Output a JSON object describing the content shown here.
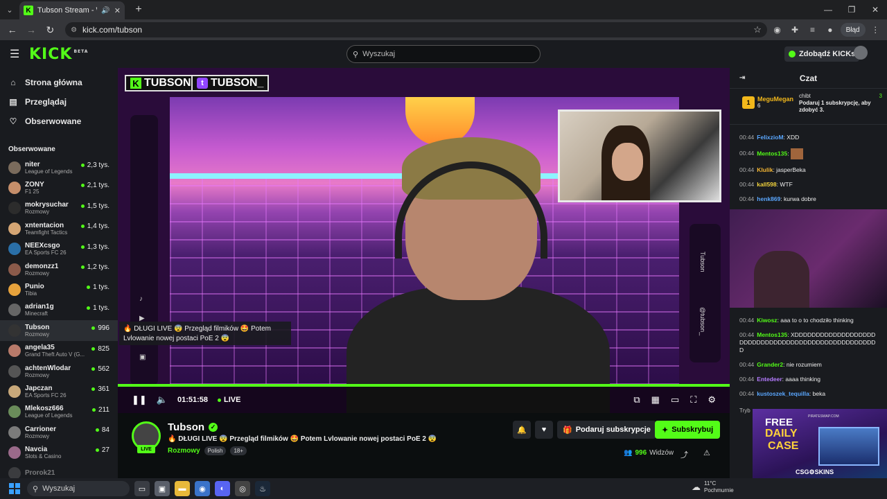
{
  "browser": {
    "tab_title": "Tubson Stream - Watch Liv",
    "url": "kick.com/tubson",
    "error_label": "Błąd"
  },
  "header": {
    "logo": "KICK",
    "logo_badge": "BETA",
    "search_placeholder": "Wyszukaj",
    "kicks_label": "Zdobądź KICKs"
  },
  "sidebar": {
    "nav": [
      {
        "label": "Strona główna",
        "icon": "home-icon"
      },
      {
        "label": "Przeglądaj",
        "icon": "browse-icon"
      },
      {
        "label": "Obserwowane",
        "icon": "heart-icon"
      }
    ],
    "followed_title": "Obserwowane",
    "channels": [
      {
        "name": "niter",
        "category": "League of Legends",
        "viewers": "2,3 tys."
      },
      {
        "name": "ZONY",
        "category": "F1 25",
        "viewers": "2,1 tys."
      },
      {
        "name": "mokrysuchar",
        "category": "Rozmowy",
        "viewers": "1,5 tys."
      },
      {
        "name": "xntentacion",
        "category": "Teamfight Tactics",
        "viewers": "1,4 tys."
      },
      {
        "name": "NEEXcsgo",
        "category": "EA Sports FC 26",
        "viewers": "1,3 tys."
      },
      {
        "name": "demonzz1",
        "category": "Rozmowy",
        "viewers": "1,2 tys."
      },
      {
        "name": "Punio",
        "category": "Tibia",
        "viewers": "1 tys."
      },
      {
        "name": "adrian1g",
        "category": "Minecraft",
        "viewers": "1 tys."
      },
      {
        "name": "Tubson",
        "category": "Rozmowy",
        "viewers": "996"
      },
      {
        "name": "angela35",
        "category": "Grand Theft Auto V (G...",
        "viewers": "825"
      },
      {
        "name": "achtenWlodar",
        "category": "Rozmowy",
        "viewers": "562"
      },
      {
        "name": "Japczan",
        "category": "EA Sports FC 26",
        "viewers": "361"
      },
      {
        "name": "Mlekosz666",
        "category": "League of Legends",
        "viewers": "211"
      },
      {
        "name": "Carrioner",
        "category": "Rozmowy",
        "viewers": "84"
      },
      {
        "name": "Navcia",
        "category": "Slots & Casino",
        "viewers": "27"
      },
      {
        "name": "Prorok21",
        "category": "",
        "viewers": ""
      }
    ]
  },
  "video": {
    "tag_kick": "TUBSON",
    "tag_twitch": "TUBSON_",
    "caption": "🔥 DŁUGI LIVE 😨 Przegląd filmików 🤩 Potem Lvlowanie nowej postaci PoE 2 😨",
    "time": "01:51:58",
    "live_label": "LIVE",
    "rail_name": "Tubson",
    "rail_handle": "@tubson_"
  },
  "stream": {
    "name": "Tubson",
    "live_badge": "LIVE",
    "title": "🔥 DŁUGI LIVE 😨 Przegląd filmików 🤩 Potem Lvlowanie nowej postaci PoE 2 😨",
    "category": "Rozmowy",
    "tags": [
      "Polish",
      "18+"
    ],
    "gift_label": "Podaruj subskrypcje",
    "subscribe_label": "Subskrybuj",
    "viewers_count": "996",
    "viewers_label": "Widzów"
  },
  "chat": {
    "title": "Czat",
    "pinned_left_rank": "1",
    "pinned_left_name": "MeguMegan",
    "pinned_left_count": "6",
    "pinned_right_name": "chibt",
    "pinned_right_count": "3",
    "pinned_right_text": "Podaruj 1 subskrypcję, aby zdobyć 3.",
    "messages": [
      {
        "time": "00:44",
        "user": "FelixzioM",
        "color": "#5aa7ff",
        "text": "XDD"
      },
      {
        "time": "00:44",
        "user": "Mentos135",
        "color": "#53fc18",
        "text": ""
      },
      {
        "time": "00:44",
        "user": "Klulik",
        "color": "#f7b733",
        "text": "jasperBeka"
      },
      {
        "time": "00:44",
        "user": "kall598",
        "color": "#f2d33c",
        "text": "WTF"
      },
      {
        "time": "00:44",
        "user": "henk869",
        "color": "#5aa7ff",
        "text": "kurwa dobre"
      }
    ],
    "messages2": [
      {
        "time": "00:44",
        "user": "Kiwosz",
        "color": "#53fc18",
        "text": "aaa to o to chodziło thinking"
      },
      {
        "time": "00:44",
        "user": "Mentos135",
        "color": "#53fc18",
        "text": "XDDDDDDDDDDDDDDDDDDDDDDDDDDDDDDDDDDDDDDDDDDDDDDDDDDDD"
      },
      {
        "time": "00:44",
        "user": "Grander2",
        "color": "#53fc18",
        "text": "nie rozumiem"
      },
      {
        "time": "00:44",
        "user": "Entedeer",
        "color": "#b57bff",
        "text": "aaaa thinking"
      },
      {
        "time": "00:44",
        "user": "kustoszek_tequilla",
        "color": "#5aa7ff",
        "text": "beka"
      }
    ],
    "mode_text": "Tryb"
  },
  "ad": {
    "free": "FREE",
    "daily": "DAILY",
    "case": "CASE",
    "brand": "CSG⚙SKINS",
    "tiny": "PIRATESWAP.COM"
  },
  "taskbar": {
    "search_placeholder": "Wyszukaj",
    "temp": "11°C",
    "weather": "Pochmurnie"
  },
  "colors": {
    "accent": "#53fc18",
    "bg": "#0b0e0f",
    "panel": "#191b1f"
  }
}
